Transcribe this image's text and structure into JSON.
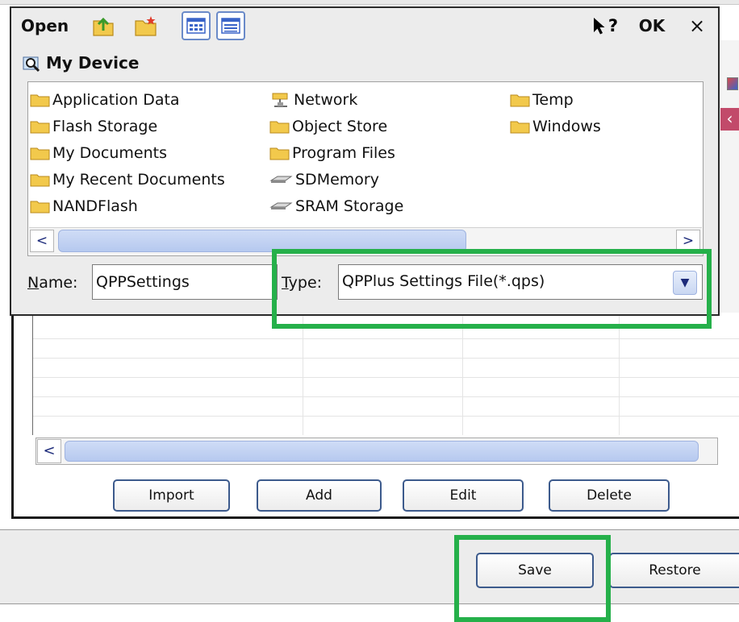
{
  "dialog": {
    "title": "Open",
    "ok_label": "OK",
    "close_glyph": "×",
    "help_glyph": "?",
    "toolbar_icons": [
      "up-folder-icon",
      "new-folder-icon",
      "list-view-icon",
      "details-view-icon"
    ],
    "location": "My Device",
    "files": {
      "col1": [
        "Application Data",
        "Flash Storage",
        "My Documents",
        "My Recent Documents",
        "NANDFlash"
      ],
      "col2": [
        "Network",
        "Object Store",
        "Program Files",
        "SDMemory",
        "SRAM Storage"
      ],
      "col3": [
        "Temp",
        "Windows"
      ]
    },
    "name_label_mnemonic": "N",
    "name_label_rest": "ame:",
    "name_value": "QPPSettings",
    "type_label_mnemonic": "T",
    "type_label_rest": "ype:",
    "type_value": "QPPlus Settings File(*.qps)"
  },
  "background": {
    "buttons": {
      "import": "Import",
      "add": "Add",
      "edit": "Edit",
      "delete": "Delete",
      "save": "Save",
      "restore": "Restore"
    }
  },
  "colors": {
    "highlight": "#25b04a",
    "scroll_thumb": "#b6c9ef",
    "folder": "#f2c94c"
  }
}
